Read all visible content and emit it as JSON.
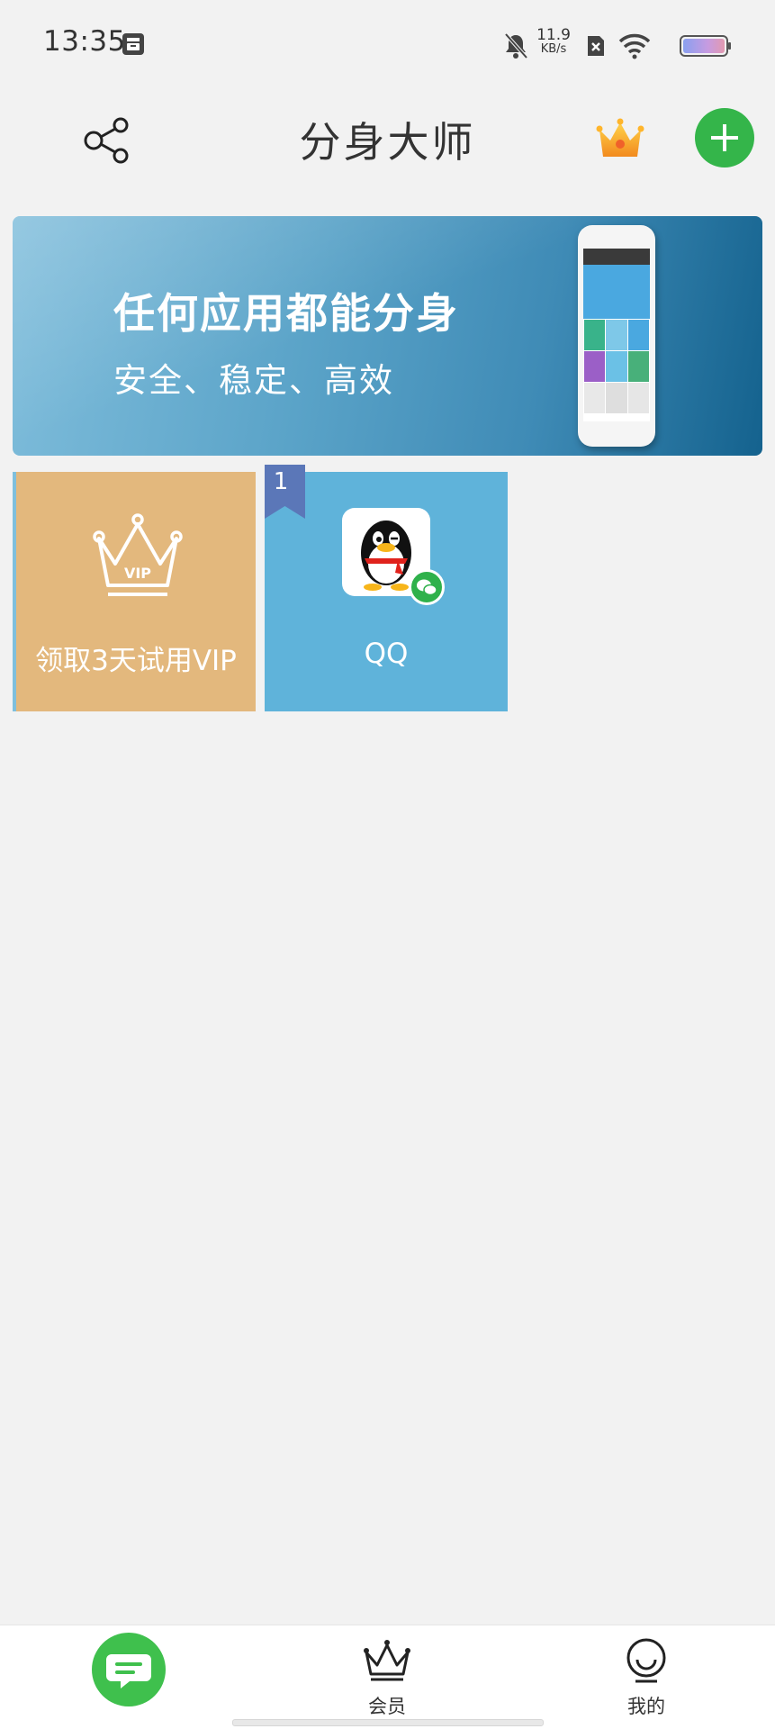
{
  "status_bar": {
    "time": "13:35",
    "net_speed_value": "11.9",
    "net_speed_unit": "KB/s"
  },
  "header": {
    "title": "分身大师"
  },
  "banner": {
    "title": "任何应用都能分身",
    "subtitle": "安全、稳定、高效"
  },
  "tiles": [
    {
      "label": "领取3天试用VIP",
      "icon": "vip-crown-icon",
      "color": "#e3b87d"
    },
    {
      "label": "QQ",
      "icon": "qq-app-icon",
      "badge": "1",
      "color": "#5fb3da"
    }
  ],
  "bottom_nav": {
    "items": [
      {
        "icon": "chat-icon",
        "label": ""
      },
      {
        "icon": "crown-icon",
        "label": "会员"
      },
      {
        "icon": "person-icon",
        "label": "我的"
      }
    ]
  },
  "colors": {
    "accent_green": "#34b54a",
    "background": "#f2f2f2"
  }
}
